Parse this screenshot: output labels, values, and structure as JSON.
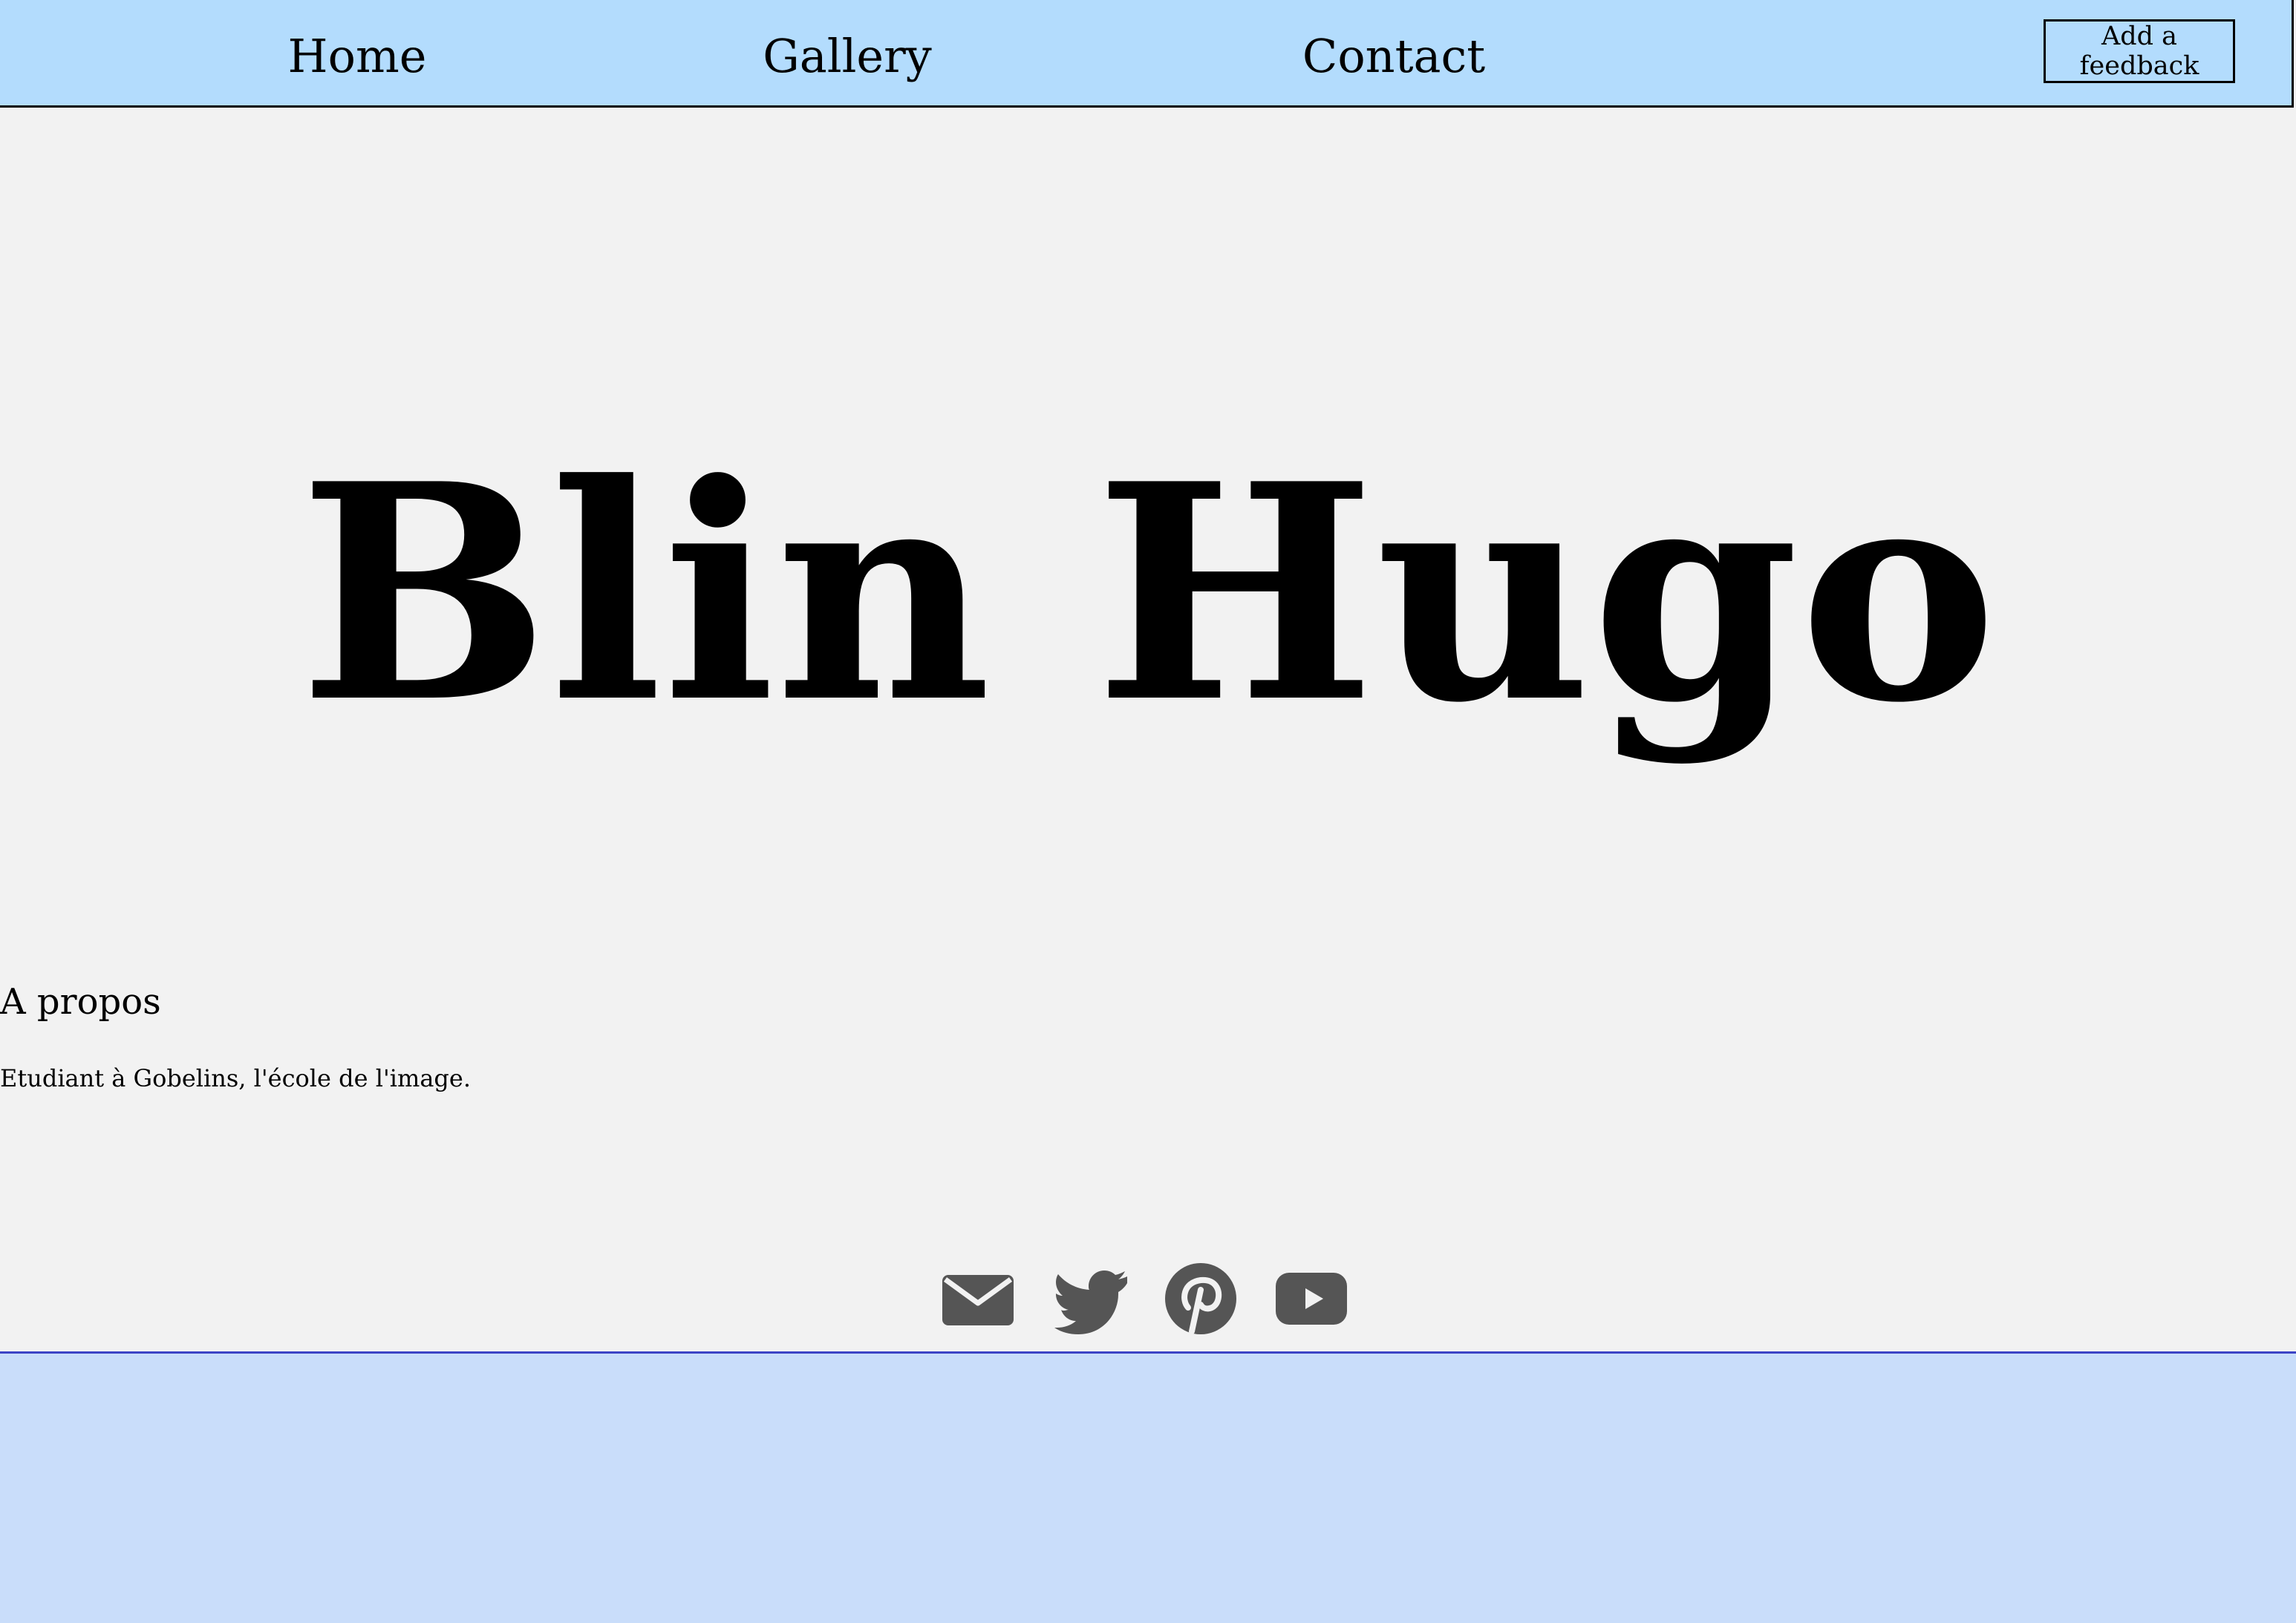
{
  "nav": {
    "home_label": "Home",
    "gallery_label": "Gallery",
    "contact_label": "Contact",
    "feedback_button_label": "Add a feedback"
  },
  "hero": {
    "title": "Blin Hugo"
  },
  "about": {
    "heading": "A propos",
    "text": "Etudiant à Gobelins, l'école de l'image."
  },
  "social": {
    "icons": [
      "mail-icon",
      "twitter-icon",
      "pinterest-icon",
      "youtube-icon"
    ],
    "icon_color": "#555555"
  },
  "colors": {
    "nav_background": "#b3dcfd",
    "page_background": "#f2f2f2",
    "footer_background": "#c9ddfa",
    "footer_border": "#3d44c6"
  }
}
